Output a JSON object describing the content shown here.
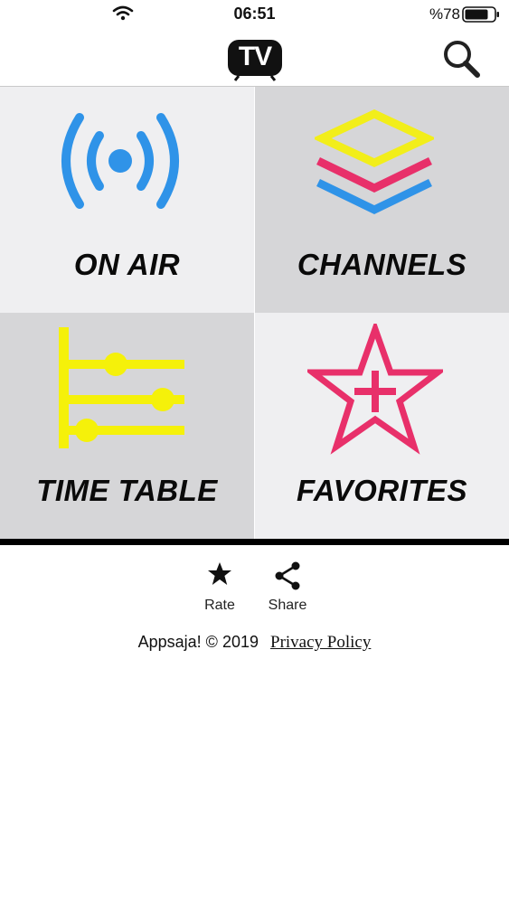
{
  "status_bar": {
    "time": "06:51",
    "battery": "%78"
  },
  "header": {
    "logo_text": "TV"
  },
  "tiles": [
    {
      "id": "on-air",
      "label": "ON AIR",
      "accent": "#2f93e8"
    },
    {
      "id": "channels",
      "label": "CHANNELS",
      "accent": "#f2ee1a"
    },
    {
      "id": "time-table",
      "label": "TIME TABLE",
      "accent": "#f5f10a"
    },
    {
      "id": "favorites",
      "label": "FAVORITES",
      "accent": "#e8306a"
    }
  ],
  "footer": {
    "rate_label": "Rate",
    "share_label": "Share",
    "credit": "Appsaja! © 2019",
    "privacy": "Privacy Policy"
  },
  "colors": {
    "blue": "#2f93e8",
    "yellow": "#f2ee1a",
    "pink": "#e8306a",
    "tile_light": "#efeff1",
    "tile_dark": "#d6d6d8"
  }
}
